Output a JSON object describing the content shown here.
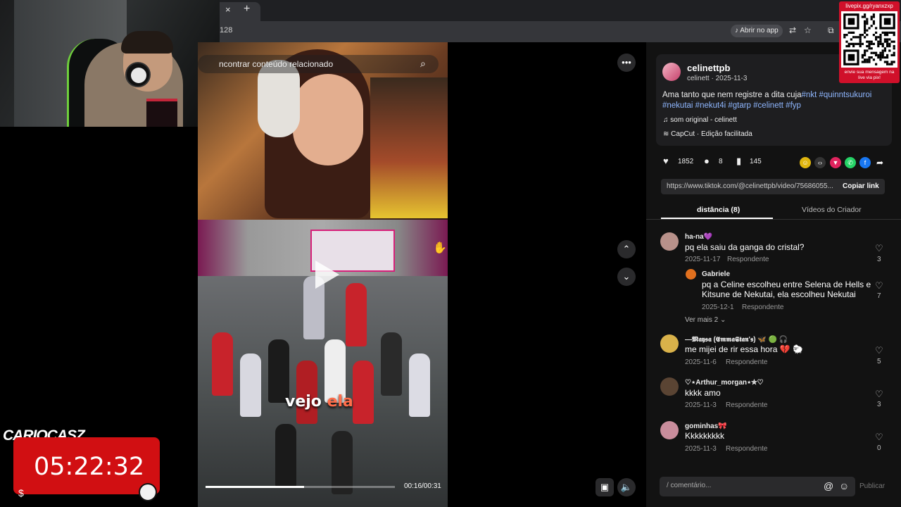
{
  "browser": {
    "tab_close": "×",
    "tab_new": "+",
    "url_fragment": "128",
    "open_app": "Abrir no app"
  },
  "video": {
    "search_placeholder": "ncontrar conteúdo relacionado",
    "caption_part1": "vejo ",
    "caption_part2": "ela",
    "time": "00:16/00:31",
    "progress": 0.52
  },
  "post": {
    "username": "celinettpb",
    "subline": "celinett · 2025-11-3",
    "desc_text": "Ama tanto que nem registre a dita cuja",
    "hashtags_line1": "#nkt #quinntsukuroi",
    "hashtags_line2": "#nekutai #nekut4i #gtarp #celinett #fyp",
    "sound": "som original - celinett",
    "capcut": "CapCut · Edição facilitada",
    "likes": "1852",
    "comments": "8",
    "saves": "145",
    "link": "https://www.tiktok.com/@celinettpb/video/75686055...",
    "copy_link": "Copiar link"
  },
  "tabs": {
    "comments": "distância (8)",
    "creator_videos": "Vídeos do Criador"
  },
  "comments": [
    {
      "name": "ha-na💜",
      "text": "pq ela saiu da ganga do cristal?",
      "date": "2025-11-17",
      "reply": "Respondente",
      "likes": "3"
    },
    {
      "name": "Gabriele",
      "text1": "pq a Celine escolheu entre Selena de Hells e",
      "text2": "Kitsune de Nekutai, ela escolheu Nekutai",
      "date": "2025-12-1",
      "reply": "Respondente",
      "likes": "7"
    },
    {
      "name": "—𝕸𝖆𝖞𝖘𝖆 (𝕰𝖒𝖒𝖆𝕾𝖙𝖆𝖓'𝖘) 🦋 🟢 🎧",
      "text": "me mijei de rir essa hora 💔 🐑",
      "date": "2025-11-6",
      "reply": "Respondente",
      "likes": "5"
    },
    {
      "name": "♡⋆Arthur_morgan⋆✮♡",
      "text": "kkkk amo",
      "date": "2025-11-3",
      "reply": "Respondente",
      "likes": "3"
    },
    {
      "name": "gominhas🎀",
      "text": "Kkkkkkkkk",
      "date": "2025-11-3",
      "reply": "Respondente",
      "likes": "0"
    }
  ],
  "see_more": "Ver mais 2 ⌄",
  "comment_box": {
    "placeholder": "/  comentário...",
    "publish": "Publicar"
  },
  "qr": {
    "top": "livepix.gg/ryanxzxp",
    "bottom": "envie sua mensagem na live via pix!"
  },
  "overlay": {
    "streamer": "CARIOCASZ",
    "timer": "05:22:32",
    "dollar": "$"
  },
  "colors": {
    "accent_red": "#d10f12",
    "hashtag": "#8fb7ff"
  }
}
